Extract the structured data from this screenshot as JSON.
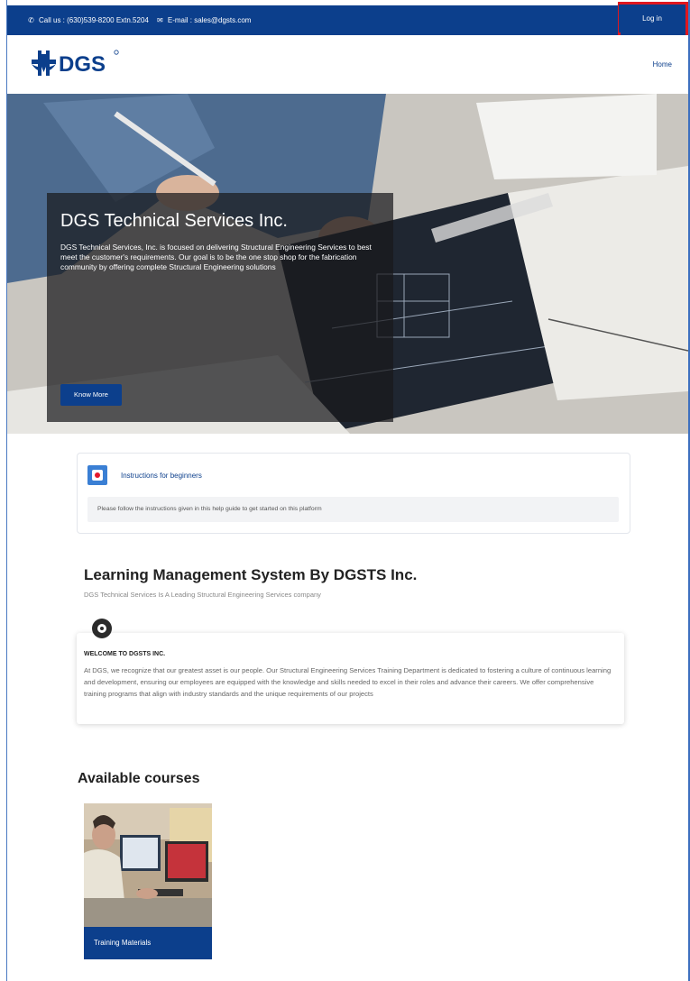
{
  "topbar": {
    "phone_text": "Call us : (630)539-8200 Extn.5204",
    "email_text": "E-mail : sales@dgsts.com",
    "login_label": "Log in"
  },
  "navbar": {
    "logo_text": "DGS",
    "home_label": "Home"
  },
  "hero": {
    "title": "DGS Technical Services Inc.",
    "text": "DGS Technical Services, Inc. is focused on delivering Structural Engineering Services to best meet the customer's requirements. Our goal is to be the one stop shop for the fabrication community by offering complete Structural Engineering solutions",
    "button_label": "Know More"
  },
  "instructions": {
    "title": "Instructions for beginners",
    "body": "Please follow the instructions given in this help guide to get started on this platform"
  },
  "lms": {
    "title": "Learning Management System By DGSTS Inc.",
    "subtitle": "DGS Technical Services Is A Leading Structural Engineering Services company"
  },
  "welcome": {
    "heading": "WELCOME TO DGSTS INC.",
    "text": "At DGS, we recognize that our greatest asset is our people. Our Structural Engineering Services Training Department is dedicated to fostering a culture of continuous learning and development, ensuring our employees are equipped with the knowledge and skills needed to excel in their roles and advance their careers. We offer comprehensive training programs that align with industry standards and the unique requirements of our projects"
  },
  "courses": {
    "title": "Available courses",
    "items": [
      {
        "label": "Training Materials"
      }
    ]
  },
  "colors": {
    "brand_blue": "#0c3f8c",
    "highlight_red": "#e0171f",
    "link_blue": "#0c3f8c"
  }
}
